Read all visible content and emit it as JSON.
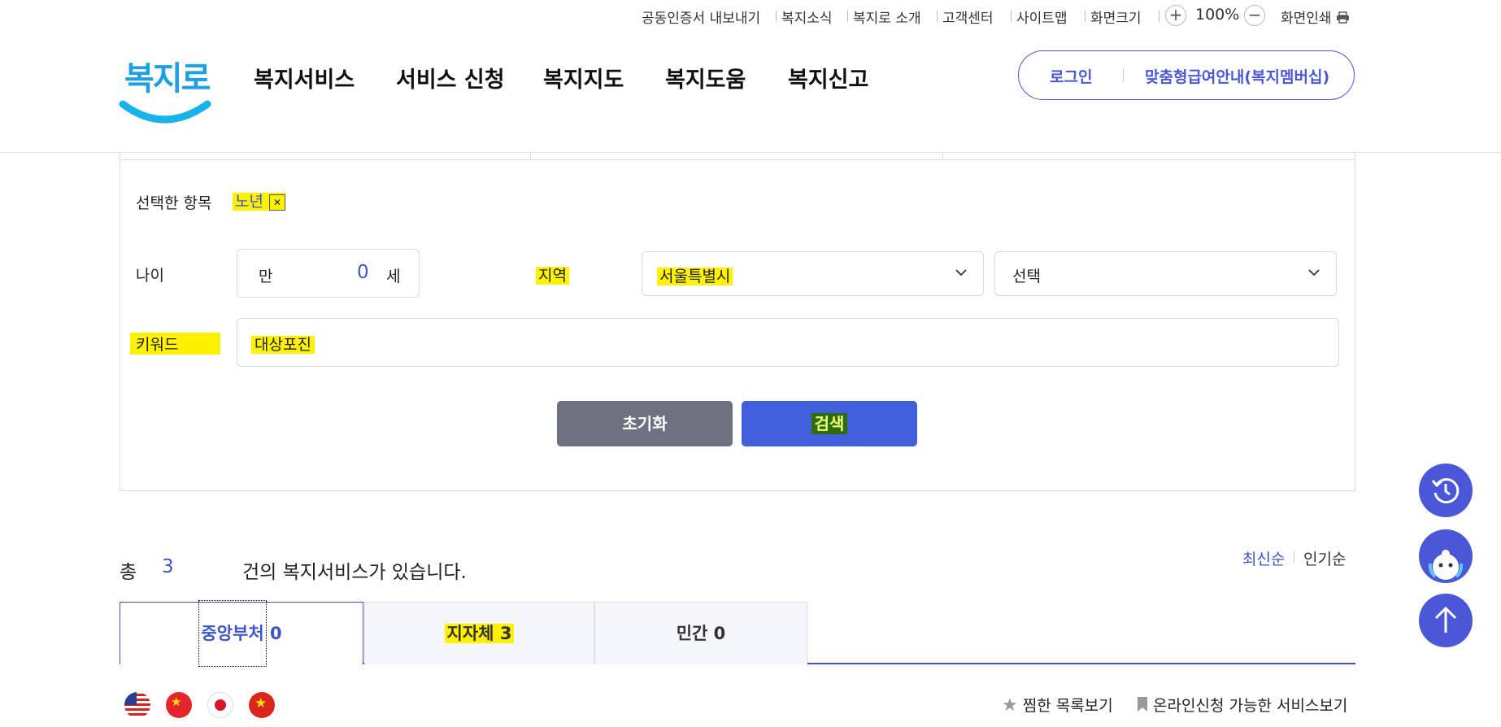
{
  "util": {
    "items": [
      "공동인증서 내보내기",
      "복지소식",
      "복지로 소개",
      "고객센터",
      "사이트맵",
      "화면크기"
    ],
    "zoom_plus": "+",
    "zoom_value": "100%",
    "zoom_minus": "−",
    "print": "화면인쇄"
  },
  "logo": {
    "text": "복지로"
  },
  "nav": [
    "복지서비스",
    "서비스 신청",
    "복지지도",
    "복지도움",
    "복지신고"
  ],
  "login": {
    "login_label": "로그인",
    "membership_label": "맞춤형급여안내(복지멤버십)"
  },
  "form": {
    "selected_label": "선택한 항목",
    "selected_tag": "노년",
    "tag_remove": "✕",
    "age_label": "나이",
    "age_prefix": "만",
    "age_value": "0",
    "age_suffix": "세",
    "region_label": "지역",
    "region_value": "서울특별시",
    "district_value": "선택",
    "keyword_label": "키워드",
    "keyword_value": "대상포진",
    "reset_label": "초기화",
    "search_label": "검색"
  },
  "results": {
    "total_prefix": "총",
    "total_count": "3",
    "total_suffix": "건의 복지서비스가 있습니다.",
    "sort_latest": "최신순",
    "sort_popular": "인기순",
    "tabs": [
      {
        "label": "중앙부처",
        "count": "0"
      },
      {
        "label": "지자체",
        "count": "3"
      },
      {
        "label": "민간",
        "count": "0"
      }
    ],
    "bookmark_label": "찜한 목록보기",
    "online_label": "온라인신청 가능한 서비스보기"
  },
  "flags": [
    "us-flag-icon",
    "china-flag-icon",
    "japan-flag-icon",
    "vietnam-flag-icon"
  ],
  "colors": {
    "accent": "#4a57d6",
    "highlight": "#fff200",
    "reset_button": "#6e7180",
    "search_button": "#3f5fdb"
  }
}
